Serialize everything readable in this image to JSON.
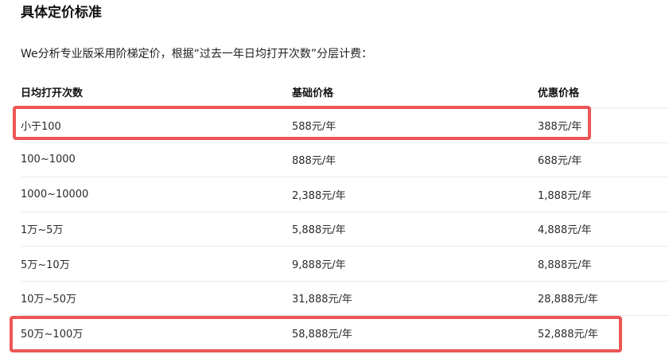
{
  "heading": "具体定价标准",
  "intro": "We分析专业版采用阶梯定价，根据“过去一年日均打开次数”分层计费：",
  "table": {
    "headers": [
      "日均打开次数",
      "基础价格",
      "优惠价格"
    ],
    "rows": [
      [
        "小于100",
        "588元/年",
        "388元/年"
      ],
      [
        "100~1000",
        "888元/年",
        "688元/年"
      ],
      [
        "1000~10000",
        "2,388元/年",
        "1,888元/年"
      ],
      [
        "1万~5万",
        "5,888元/年",
        "4,888元/年"
      ],
      [
        "5万~10万",
        "9,888元/年",
        "8,888元/年"
      ],
      [
        "10万~50万",
        "31,888元/年",
        "28,888元/年"
      ],
      [
        "50万~100万",
        "58,888元/年",
        "52,888元/年"
      ]
    ]
  },
  "highlight_color": "#ee5656",
  "highlighted_rows": [
    "小于100",
    "50万~100万"
  ]
}
